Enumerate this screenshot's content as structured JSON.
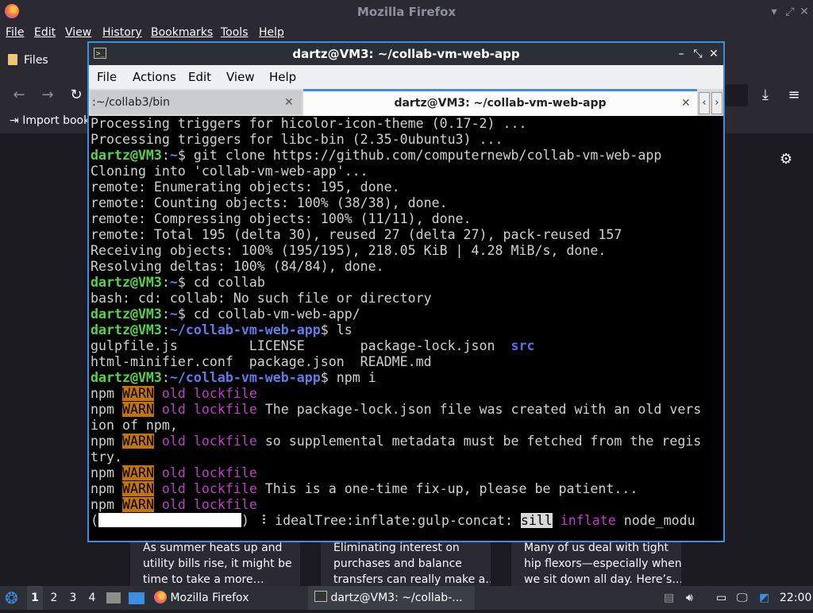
{
  "firefox": {
    "title": "Mozilla Firefox",
    "menu": [
      "File",
      "Edit",
      "View",
      "History",
      "Bookmarks",
      "Tools",
      "Help"
    ],
    "files_tab": "Files",
    "import_bookmarks": "Import book",
    "cards": [
      [
        "As summer heats up and",
        "utility bills rise, it might be",
        "time to take a more…"
      ],
      [
        "Eliminating interest on",
        "purchases and balance",
        "transfers can really make a…"
      ],
      [
        "Many of us deal with tight",
        "hip flexors—especially when",
        "we sit down all day. Here’s…"
      ]
    ]
  },
  "terminal": {
    "title": "dartz@VM3: ~/collab-vm-web-app",
    "menu": [
      "File",
      "Actions",
      "Edit",
      "View",
      "Help"
    ],
    "tabs": [
      {
        "label": ":~/collab3/bin",
        "active": false
      },
      {
        "label": "dartz@VM3: ~/collab-vm-web-app",
        "active": true
      }
    ],
    "lines": [
      {
        "text": "Processing triggers for hicolor-icon-theme (0.17-2) ..."
      },
      {
        "text": "Processing triggers for libc-bin (2.35-0ubuntu3) ..."
      },
      {
        "user": "dartz@VM3",
        "path": "~",
        "cmd": " git clone https://github.com/computernewb/collab-vm-web-app"
      },
      {
        "text": "Cloning into 'collab-vm-web-app'..."
      },
      {
        "text": "remote: Enumerating objects: 195, done."
      },
      {
        "text": "remote: Counting objects: 100% (38/38), done."
      },
      {
        "text": "remote: Compressing objects: 100% (11/11), done."
      },
      {
        "text": "remote: Total 195 (delta 30), reused 27 (delta 27), pack-reused 157"
      },
      {
        "text": "Receiving objects: 100% (195/195), 218.05 KiB | 4.28 MiB/s, done."
      },
      {
        "text": "Resolving deltas: 100% (84/84), done."
      },
      {
        "user": "dartz@VM3",
        "path": "~",
        "cmd": " cd collab"
      },
      {
        "text": "bash: cd: collab: No such file or directory"
      },
      {
        "user": "dartz@VM3",
        "path": "~",
        "cmd": " cd collab-vm-web-app/"
      },
      {
        "user": "dartz@VM3",
        "path": "~/collab-vm-web-app",
        "cmd": " ls"
      },
      {
        "text": "gulpfile.js         LICENSE       package-lock.json  ",
        "dir": "src"
      },
      {
        "text": "html-minifier.conf  package.json  README.md"
      },
      {
        "user": "dartz@VM3",
        "path": "~/collab-vm-web-app",
        "cmd": " npm i"
      },
      {
        "npm": true,
        "msg": ""
      },
      {
        "npm": true,
        "msg": " The package-lock.json file was created with an old vers"
      },
      {
        "text": "ion of npm,"
      },
      {
        "npm": true,
        "msg": " so supplemental metadata must be fetched from the regis"
      },
      {
        "text": "try."
      },
      {
        "npm": true,
        "msg": ""
      },
      {
        "npm": true,
        "msg": " This is a one-time fix-up, please be patient..."
      },
      {
        "npm": true,
        "msg": ""
      },
      {
        "progress": true,
        "stage": " ⠸ idealTree:inflate:gulp-concat: ",
        "level": "sill",
        "action": "inflate",
        "rest": " node_modu"
      }
    ],
    "npm_tokens": {
      "npm": "npm ",
      "warn": "WARN",
      "old": " old",
      "lockfile": " lockfile"
    }
  },
  "taskbar": {
    "workspaces": [
      "1",
      "2",
      "3",
      "4"
    ],
    "apps": [
      "Mozilla Firefox",
      "dartz@VM3: ~/collab-..."
    ],
    "clock": "22:00"
  }
}
